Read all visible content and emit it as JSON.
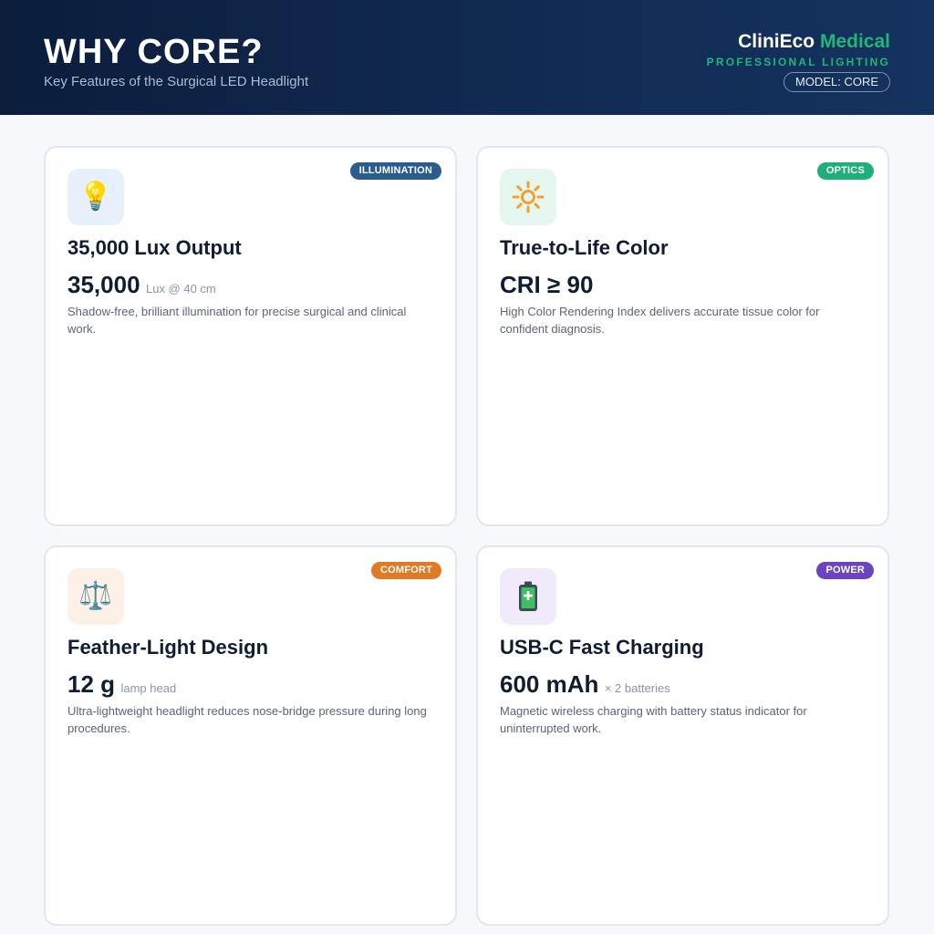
{
  "header": {
    "title": "WHY CORE?",
    "subtitle": "Key Features of the Surgical LED Headlight",
    "brand_primary": "CliniEco",
    "brand_accent": "Medical",
    "tagline": "PROFESSIONAL LIGHTING",
    "model": "MODEL: CORE"
  },
  "colors": {
    "accent_green": "#21b57a",
    "navy": "#0c1d3c"
  },
  "cards": [
    {
      "badge": "ILLUMINATION",
      "badge_color": "#2b5c8f",
      "icon": "lightbulb-icon",
      "icon_bg": "#e8f1fb",
      "title": "35,000 Lux Output",
      "value": "35,000",
      "unit": "Lux @ 40 cm",
      "description": "Shadow-free, brilliant illumination for precise surgical and clinical work."
    },
    {
      "badge": "OPTICS",
      "badge_color": "#1fb07a",
      "icon": "sun-icon",
      "icon_bg": "#e5f6ee",
      "title": "True-to-Life Color",
      "value": "CRI ≥ 90",
      "unit": "",
      "description": "High Color Rendering Index delivers accurate tissue color for confident diagnosis."
    },
    {
      "badge": "COMFORT",
      "badge_color": "#e07a25",
      "icon": "scales-icon",
      "icon_bg": "#fdf0e6",
      "title": "Feather-Light Design",
      "value": "12 g",
      "unit": "lamp head",
      "description": "Ultra-lightweight headlight reduces nose-bridge pressure during long procedures."
    },
    {
      "badge": "POWER",
      "badge_color": "#6a45bf",
      "icon": "battery-icon",
      "icon_bg": "#f0eafb",
      "title": "USB-C Fast Charging",
      "value": "600 mAh",
      "unit": "× 2 batteries",
      "description": "Magnetic wireless charging with battery status indicator for uninterrupted work."
    }
  ]
}
